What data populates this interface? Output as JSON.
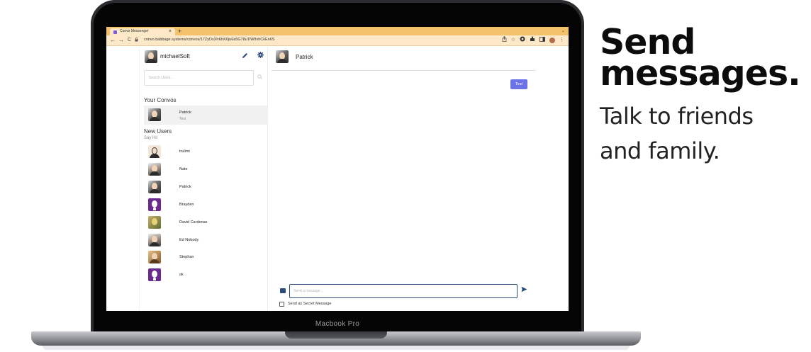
{
  "browser": {
    "tab_title": "Convo Messenger",
    "tab_close": "×",
    "new_tab": "+",
    "tab_menu": "⌄",
    "url": "convo.babbage.systems/convos/17ZyDsXhKhK0ju6a5G78uTiW9vhCkEn6S",
    "nav_back": "←",
    "nav_forward": "→",
    "nav_reload": "C"
  },
  "sidebar": {
    "username": "michaelSoft",
    "search_placeholder": "Search Users...",
    "convos_title": "Your Convos",
    "convos": [
      {
        "name": "Patrick",
        "last_message": "Test"
      }
    ],
    "new_users_title": "New Users",
    "new_users_subtitle": "Say Hi!",
    "new_users": [
      {
        "name": "trulimi",
        "avatar": "cartoon-bald-avatar"
      },
      {
        "name": "Nate",
        "avatar": "photo-avatar"
      },
      {
        "name": "Patrick",
        "avatar": "photo-avatar"
      },
      {
        "name": "Brayden",
        "avatar": "purple-icon-avatar"
      },
      {
        "name": "David Cardenas",
        "avatar": "emblem-avatar"
      },
      {
        "name": "Ed Nobody",
        "avatar": "photo-avatar"
      },
      {
        "name": "Stephan",
        "avatar": "photo-avatar"
      },
      {
        "name": "ok",
        "avatar": "purple-icon-avatar"
      }
    ]
  },
  "chat": {
    "contact_name": "Patrick",
    "messages": [
      {
        "text": "Test",
        "from_me": true
      }
    ],
    "input_placeholder": "Send a message...",
    "secret_label": "Send as Secret Message"
  },
  "device": {
    "label": "Macbook Pro"
  },
  "marketing": {
    "headline_line1": "Send",
    "headline_line2": "messages.",
    "tagline_line1": "Talk to friends",
    "tagline_line2": "and family."
  },
  "colors": {
    "tabbar": "#f4c16c",
    "addressbar": "#fde9c7",
    "accent_bubble": "#6b72e6",
    "icon_navy": "#2c4a7a"
  }
}
